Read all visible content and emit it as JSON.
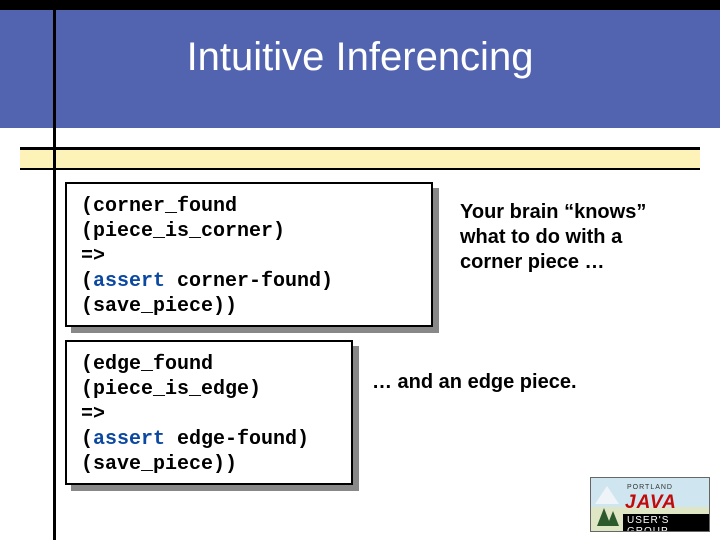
{
  "title": "Intuitive Inferencing",
  "code1": {
    "line1": "(corner_found",
    "line2": "(piece_is_corner)",
    "line3": "=>",
    "line4a": "(",
    "line4kw": "assert",
    "line4b": " corner-found)",
    "line5": "(save_piece))"
  },
  "code2": {
    "line1": "(edge_found",
    "line2": "(piece_is_edge)",
    "line3": "=>",
    "line4a": "(",
    "line4kw": "assert",
    "line4b": " edge-found)",
    "line5": "(save_piece))"
  },
  "note1": "Your brain “knows” what to do with a corner piece …",
  "note2": "… and an edge piece.",
  "logo": {
    "portland": "PORTLAND",
    "java": "JAVA",
    "ug": "USER'S GROUP"
  }
}
